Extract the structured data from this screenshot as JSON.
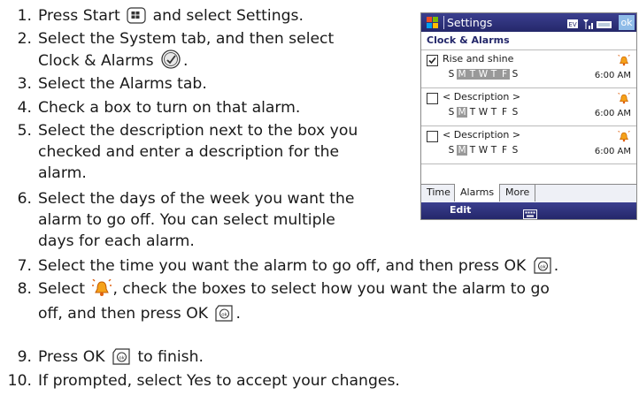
{
  "steps": [
    {
      "num": "1.",
      "lines": [
        "Press Start",
        "and select Settings."
      ]
    },
    {
      "num": "2.",
      "lines": [
        "Select the System tab, and then select",
        "Clock & Alarms",
        "."
      ]
    },
    {
      "num": "3.",
      "lines": [
        "Select the Alarms tab."
      ]
    },
    {
      "num": "4.",
      "lines": [
        "Check a box to turn on that alarm."
      ]
    },
    {
      "num": "5.",
      "lines": [
        "Select the description next to the box you",
        "checked and enter a description for the",
        "alarm."
      ]
    },
    {
      "num": "6.",
      "lines": [
        "Select the days of the week you want the",
        "alarm to go off. You can select multiple",
        "days for each alarm."
      ]
    },
    {
      "num": "7.",
      "lines": [
        "Select the time you want the alarm to go off, and then press OK",
        "."
      ]
    },
    {
      "num": "8.",
      "lines": [
        "Select",
        ", check the boxes to select how you want the alarm to go",
        "off, and then press OK",
        "."
      ]
    },
    {
      "num": "9.",
      "lines": [
        "Press OK",
        "to finish."
      ]
    },
    {
      "num": "10.",
      "lines": [
        "If prompted, select Yes to accept your changes."
      ]
    }
  ],
  "phone": {
    "title": "Settings",
    "ok_label": "ok",
    "header": "Clock & Alarms",
    "alarms": [
      {
        "checked": true,
        "description": "Rise and shine",
        "days": [
          "S",
          "M",
          "T",
          "W",
          "T",
          "F",
          "S"
        ],
        "selected_days": [
          1,
          2,
          3,
          4,
          5
        ],
        "time": "6:00 AM"
      },
      {
        "checked": false,
        "description": "< Description >",
        "days": [
          "S",
          "M",
          "T",
          "W",
          "T",
          "F",
          "S"
        ],
        "selected_days": [
          1
        ],
        "time": "6:00 AM"
      },
      {
        "checked": false,
        "description": "< Description >",
        "days": [
          "S",
          "M",
          "T",
          "W",
          "T",
          "F",
          "S"
        ],
        "selected_days": [
          1
        ],
        "time": "6:00 AM"
      }
    ],
    "tabs": [
      {
        "label": "Time",
        "active": false
      },
      {
        "label": "Alarms",
        "active": true
      },
      {
        "label": "More",
        "active": false
      }
    ],
    "softkey_left": "Edit"
  }
}
